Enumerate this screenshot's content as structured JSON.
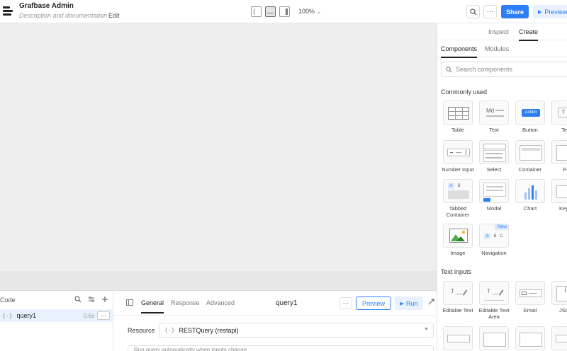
{
  "app": {
    "title": "Grafbase Admin",
    "description": "Description and documentation",
    "edit_label": "Edit",
    "zoom": "100%",
    "zoom_caret": "⌄"
  },
  "toolbar": {
    "search_icon": "search-icon",
    "more_label": "···",
    "share_label": "Share",
    "preview_label": "Preview",
    "preview_icon": "▶"
  },
  "right_panel": {
    "tabs": [
      "Inspect",
      "Create"
    ],
    "active_tab": "Create",
    "subtabs": [
      "Components",
      "Modules"
    ],
    "active_subtab": "Components",
    "search_placeholder": "Search components",
    "sections": {
      "common": "Commonly used",
      "text_inputs": "Text inputs"
    },
    "common_components": [
      {
        "label": "Table",
        "icon": "table-icon"
      },
      {
        "label": "Text",
        "icon": "text-icon"
      },
      {
        "label": "Button",
        "icon": "button-icon"
      },
      {
        "label": "Text",
        "icon": "text-icon"
      },
      {
        "label": "Number Input",
        "icon": "number-input-icon"
      },
      {
        "label": "Select",
        "icon": "select-icon"
      },
      {
        "label": "Container",
        "icon": "container-icon"
      },
      {
        "label": "Fo",
        "icon": "form-icon"
      },
      {
        "label": "Tabbed Container",
        "icon": "tabbed-container-icon"
      },
      {
        "label": "Modal",
        "icon": "modal-icon"
      },
      {
        "label": "Chart",
        "icon": "chart-icon"
      },
      {
        "label": "Key V",
        "icon": "key-value-icon"
      },
      {
        "label": "Image",
        "icon": "image-icon"
      },
      {
        "label": "Navigation",
        "icon": "navigation-icon",
        "badge": "New"
      }
    ],
    "text_input_components": [
      {
        "label": "Editable Text",
        "icon": "editable-text-icon"
      },
      {
        "label": "Editable Text Area",
        "icon": "editable-text-area-icon"
      },
      {
        "label": "Email",
        "icon": "email-icon"
      },
      {
        "label": "JSON",
        "icon": "json-icon"
      }
    ],
    "tile_texts": {
      "text_md": "Md",
      "button_action": "Action",
      "tab_a": "A",
      "tab_b": "B",
      "nav_a": "A",
      "nav_b": "B",
      "nav_c": "C",
      "edit_t": "T",
      "json_braces": "{ }",
      "text_t": "T"
    }
  },
  "code_panel": {
    "title": "Code",
    "query": {
      "name": "query1",
      "time": "0.6s",
      "more": "···",
      "icon_text": "{-}"
    }
  },
  "editor": {
    "tabs": [
      "General",
      "Response",
      "Advanced"
    ],
    "active_tab": "General",
    "query_name": "query1",
    "more_label": "···",
    "preview_label": "Preview",
    "run_label": "Run",
    "run_icon": "▶",
    "resource_label": "Resource",
    "resource_icon_text": "{-}",
    "resource_value": "RESTQuery (restapi)",
    "run_auto_text": "Run query automatically when inputs change"
  },
  "colors": {
    "accent": "#2d7ff9",
    "canvas": "#eeeeee",
    "selected_row": "#e9f1fc"
  }
}
